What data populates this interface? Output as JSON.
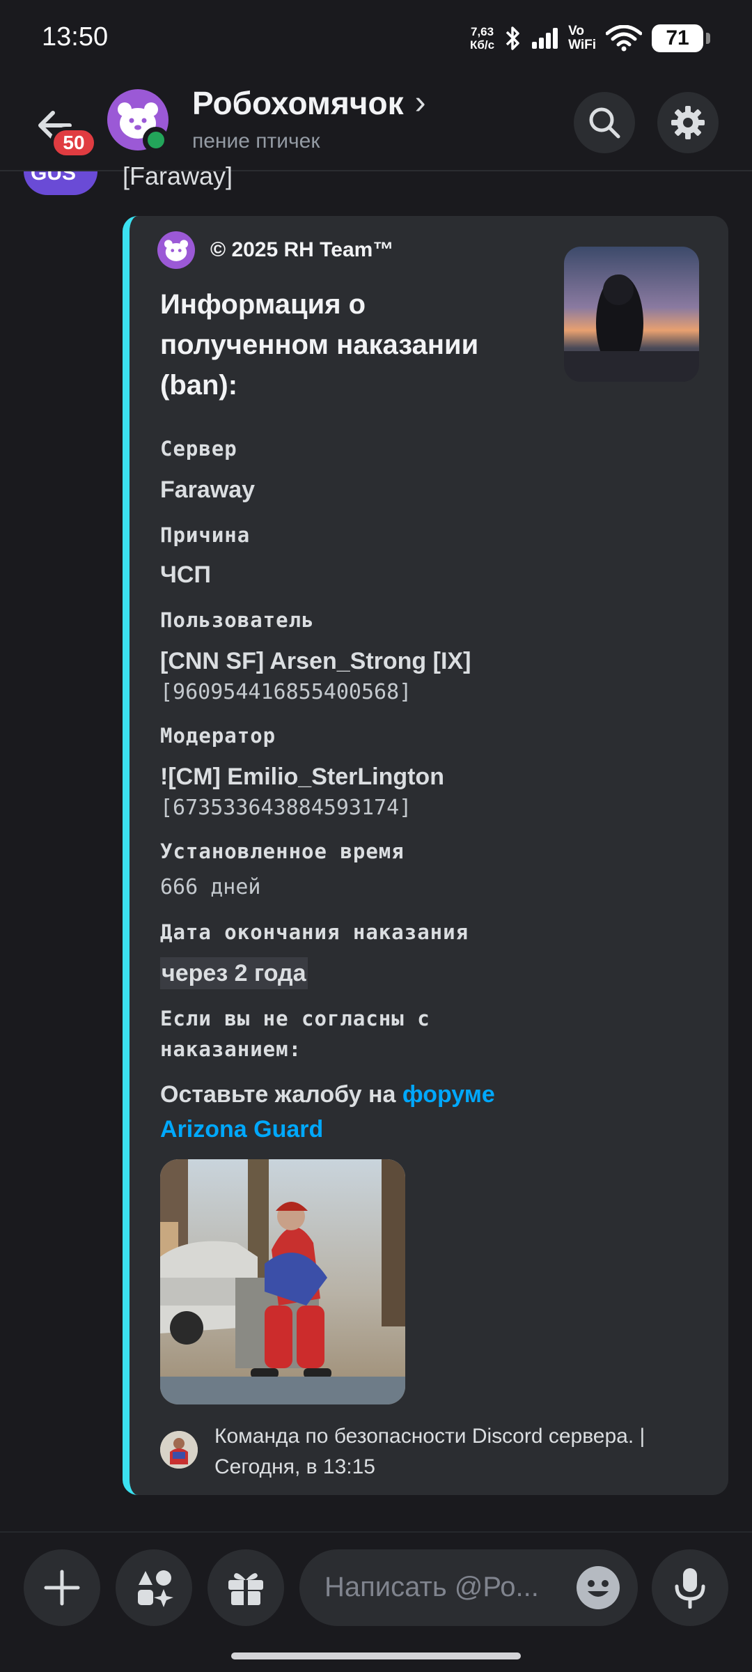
{
  "status_bar": {
    "time": "13:50",
    "net_speed_value": "7,63",
    "net_speed_unit": "Кб/с",
    "vowifi_top": "Vo",
    "vowifi_bottom": "WiFi",
    "battery": "71"
  },
  "header": {
    "unread_badge": "50",
    "channel_name": "Робохомячок",
    "chevron": "›",
    "status_text": "пение птичек",
    "icons": [
      "back-arrow-icon",
      "search-icon",
      "gear-icon"
    ]
  },
  "message": {
    "avatar_text": "GUS",
    "text": "[Faraway]"
  },
  "embed": {
    "accent_color": "#3be1f0",
    "author": "© 2025 RH Team™",
    "title": "Информация о полученном наказании (ban):",
    "fields": {
      "server": {
        "name": "Сервер",
        "value": "Faraway"
      },
      "reason": {
        "name": "Причина",
        "value": "ЧСП"
      },
      "user": {
        "name": "Пользователь",
        "value": "[CNN SF] Arsen_Strong [IX]",
        "id": "[960954416855400568]"
      },
      "moderator": {
        "name": "Модератор",
        "value": "![CM] Emilio_SterLington",
        "id": "[673533643884593174]"
      },
      "duration": {
        "name": "Установленное время",
        "value": "666 дней"
      },
      "end_date": {
        "name": "Дата окончания наказания",
        "value": "через 2 года"
      },
      "appeal": {
        "name_line1": "Если вы не согласны с",
        "name_line2": "наказанием:",
        "value_prefix": "Оставьте жалобу на ",
        "link_line1": "форуме",
        "link_line2": "Arizona Guard"
      }
    },
    "footer": {
      "text_line1": "Команда по безопасности Discord сервера. |",
      "text_line2": "Сегодня, в 13:15"
    }
  },
  "composer": {
    "placeholder": "Написать @Ро...",
    "icons": [
      "plus-icon",
      "apps-icon",
      "gift-icon",
      "emoji-icon",
      "microphone-icon"
    ]
  },
  "colors": {
    "background": "#1a1a1e",
    "embed_bg": "#2b2d31",
    "link": "#00a8fc",
    "badge": "#e03c41",
    "online": "#23a55a",
    "avatar": "#9b59d6"
  }
}
